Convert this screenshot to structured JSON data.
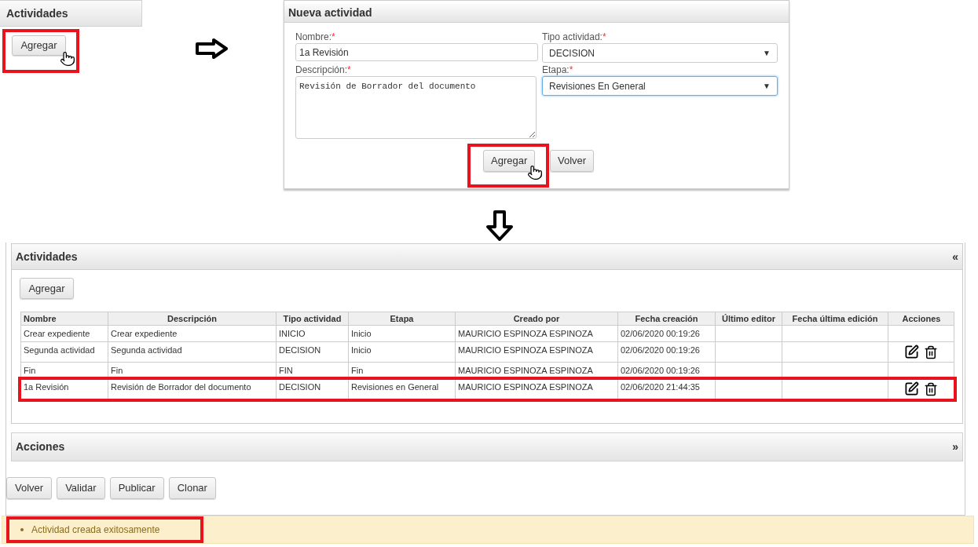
{
  "step1": {
    "panel_title": "Actividades",
    "add_button": {
      "label": "Agregar",
      "highlighted": true
    }
  },
  "step2": {
    "title": "Nueva actividad",
    "fields": [
      {
        "kind": "input",
        "label": "Nombre:",
        "required_mark": "*",
        "value": "1a Revisión",
        "focused": false
      },
      {
        "kind": "select",
        "label": "Tipo actividad:",
        "required_mark": "*",
        "value": "DECISION",
        "caret": "▼",
        "focused": false
      },
      {
        "kind": "textarea",
        "label": "Descripción:",
        "required_mark": "*",
        "value": "Revisión de Borrador del documento",
        "focused": false
      },
      {
        "kind": "select",
        "label": "Etapa:",
        "required_mark": "*",
        "value": "Revisiones En General",
        "caret": "▼",
        "focused": true
      }
    ],
    "buttons": [
      {
        "label": "Agregar",
        "highlighted": true
      },
      {
        "label": "Volver",
        "highlighted": false
      }
    ]
  },
  "step3": {
    "activities_panel": {
      "title": "Actividades",
      "toggle": "«",
      "add_button": "Agregar",
      "table": {
        "columns": [
          "Nombre",
          "Descripción",
          "Tipo actividad",
          "Etapa",
          "Creado por",
          "Fecha creación",
          "Último editor",
          "Fecha última edición",
          "Acciones"
        ],
        "rows": [
          {
            "cells": [
              "Crear expediente",
              "Crear expediente",
              "INICIO",
              "Inicio",
              "MAURICIO ESPINOZA ESPINOZA",
              "02/06/2020 00:19:26",
              "",
              ""
            ],
            "editable": false,
            "highlighted": false
          },
          {
            "cells": [
              "Segunda actividad",
              "Segunda actividad",
              "DECISION",
              "Inicio",
              "MAURICIO ESPINOZA ESPINOZA",
              "02/06/2020 00:19:26",
              "",
              ""
            ],
            "editable": true,
            "highlighted": false
          },
          {
            "cells": [
              "Fin",
              "Fin",
              "FIN",
              "Fin",
              "MAURICIO ESPINOZA ESPINOZA",
              "02/06/2020 00:19:26",
              "",
              ""
            ],
            "editable": false,
            "highlighted": false
          },
          {
            "cells": [
              "1a Revisión",
              "Revisión de Borrador del documento",
              "DECISION",
              "Revisiones en General",
              "MAURICIO ESPINOZA ESPINOZA",
              "02/06/2020 21:44:35",
              "",
              ""
            ],
            "editable": true,
            "highlighted": true
          }
        ]
      }
    },
    "actions_panel": {
      "title": "Acciones",
      "toggle": "»"
    },
    "buttons": [
      "Volver",
      "Validar",
      "Publicar",
      "Clonar"
    ],
    "message": {
      "text": "Actividad creada exitosamente",
      "highlighted": true
    }
  }
}
